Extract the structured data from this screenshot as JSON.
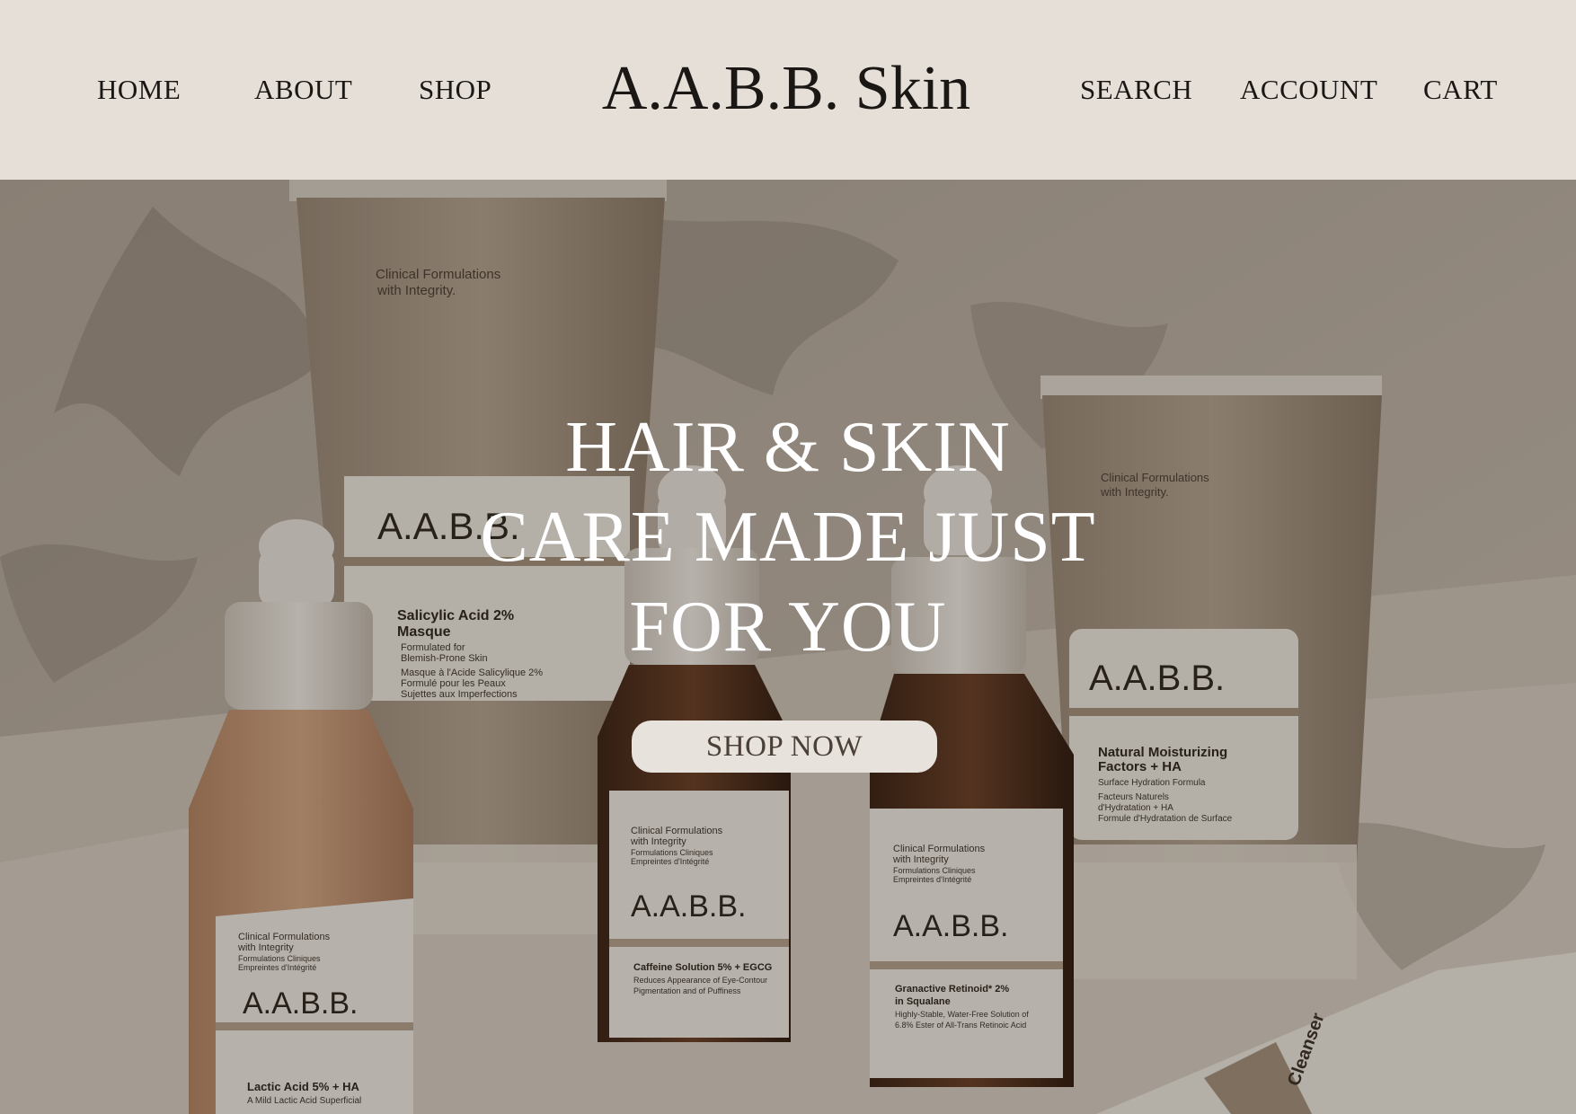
{
  "header": {
    "brand": "A.A.B.B. Skin",
    "nav_left": [
      "HOME",
      "ABOUT",
      "SHOP"
    ],
    "nav_right": [
      "SEARCH",
      "ACCOUNT",
      "CART"
    ]
  },
  "hero": {
    "headline_lines": [
      "HAIR & SKIN",
      "CARE MADE JUST",
      "FOR YOU"
    ],
    "cta_label": "SHOP NOW",
    "products": {
      "tube_left": {
        "tagline": [
          "Clinical Formulations",
          "with Integrity."
        ],
        "brand": "A.A.B.B.",
        "name": [
          "Salicylic Acid 2%",
          "Masque"
        ],
        "sub": [
          "Formulated for",
          "Blemish-Prone Skin"
        ],
        "fr": [
          "Masque à l'Acide Salicylique 2%",
          "Formulé pour les Peaux",
          "Sujettes aux Imperfections"
        ]
      },
      "tube_right": {
        "tagline": [
          "Clinical Formulations",
          "with Integrity."
        ],
        "brand": "A.A.B.B.",
        "name": [
          "Natural Moisturizing",
          "Factors + HA"
        ],
        "sub": [
          "Surface Hydration Formula"
        ],
        "fr": [
          "Facteurs Naturels",
          "d'Hydratation + HA",
          "Formule d'Hydratation de Surface"
        ]
      },
      "bottle_left": {
        "tagline": [
          "Clinical Formulations",
          "with Integrity",
          "Formulations Cliniques",
          "Empreintes d'Intégrité"
        ],
        "brand": "A.A.B.B.",
        "name": [
          "Lactic Acid 5% + HA",
          "A Mild Lactic Acid Superficial"
        ]
      },
      "bottle_mid": {
        "tagline": [
          "Clinical Formulations",
          "with Integrity",
          "Formulations Cliniques",
          "Empreintes d'Intégrité"
        ],
        "brand": "A.A.B.B.",
        "name": [
          "Caffeine Solution 5% + EGCG",
          "Reduces Appearance of Eye-Contour",
          "Pigmentation and of Puffiness"
        ]
      },
      "bottle_right": {
        "tagline": [
          "Clinical Formulations",
          "with Integrity",
          "Formulations Cliniques",
          "Empreintes d'Intégrité"
        ],
        "brand": "A.A.B.B.",
        "name": [
          "Granactive Retinoid* 2%",
          "in Squalane",
          "Highly-Stable, Water-Free Solution of",
          "6.8% Ester of All-Trans Retinoic Acid"
        ]
      },
      "tube_bottom": {
        "name": [
          "Cleanser"
        ]
      }
    }
  },
  "colors": {
    "header_bg": "#e6dfd8",
    "text_dark": "#1a1714",
    "cta_bg": "#e8e2dc",
    "cta_text": "#4a4038",
    "headline_text": "#ffffff"
  }
}
